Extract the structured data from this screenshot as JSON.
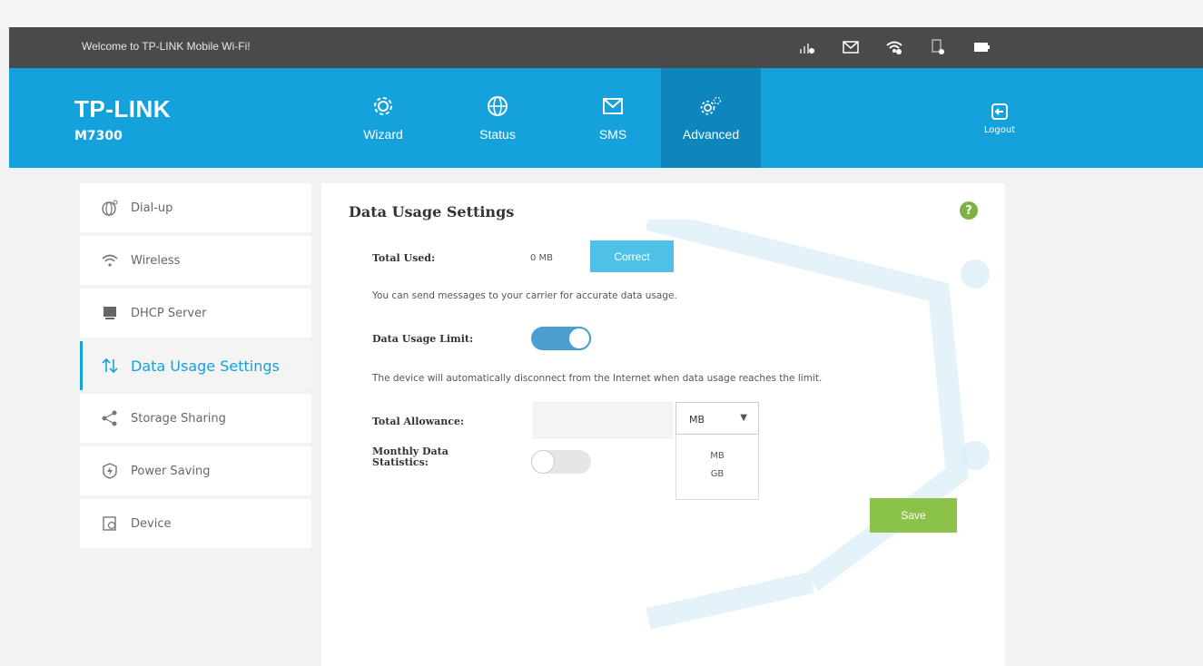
{
  "status_bar": {
    "welcome": "Welcome to TP-LINK Mobile Wi-Fi!",
    "icons": [
      "signal-icon",
      "envelope-icon",
      "wifi-icon",
      "sim-icon",
      "battery-icon"
    ]
  },
  "header": {
    "brand": "TP-LINK",
    "model": "M7300",
    "nav": [
      {
        "label": "Wizard",
        "icon": "gear-icon"
      },
      {
        "label": "Status",
        "icon": "globe-icon"
      },
      {
        "label": "SMS",
        "icon": "envelope-icon"
      },
      {
        "label": "Advanced",
        "icon": "gears-icon"
      }
    ],
    "logout": "Logout",
    "colors": {
      "header_bg": "#15a1dc",
      "active_tab": "#0d86bd",
      "status_bg": "#4a4a4a"
    }
  },
  "sidebar": {
    "items": [
      {
        "label": "Dial-up",
        "icon": "dialup-icon"
      },
      {
        "label": "Wireless",
        "icon": "wifi-icon"
      },
      {
        "label": "DHCP Server",
        "icon": "server-icon"
      },
      {
        "label": "Data Usage Settings",
        "icon": "updown-arrows-icon"
      },
      {
        "label": "Storage Sharing",
        "icon": "share-icon"
      },
      {
        "label": "Power Saving",
        "icon": "power-icon"
      },
      {
        "label": "Device",
        "icon": "device-icon"
      }
    ]
  },
  "main": {
    "title": "Data Usage Settings",
    "help_label": "?",
    "total_used_label": "Total Used:",
    "total_used_value": "0 MB",
    "correct_label": "Correct",
    "correct_note": "You can send messages to your carrier for accurate data usage.",
    "limit_label": "Data Usage Limit:",
    "limit_enabled": true,
    "limit_note": "The device will automatically disconnect from the Internet when data usage reaches the limit.",
    "allowance_label": "Total Allowance:",
    "allowance_value": "",
    "unit_selected": "MB",
    "unit_options": [
      "MB",
      "GB"
    ],
    "monthly_label": "Monthly Data Statistics:",
    "monthly_enabled": false,
    "save_label": "Save",
    "colors": {
      "save": "#8bc34a",
      "correct": "#4fc1e9",
      "toggle_on": "#4b9fcf",
      "help": "#7cb342"
    }
  }
}
